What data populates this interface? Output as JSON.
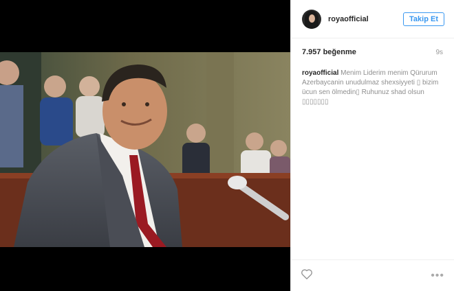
{
  "post": {
    "username": "royaofficial",
    "follow_label": "Takip Et",
    "likes": "7.957 beğenme",
    "time_ago": "9s",
    "caption_user": "royaofficial",
    "caption_text": "Menim Liderim menim Qürurum Azerbaycanin unudulmaz shexsiyyeti ▯ bizim ücun sen ölmedin▯ Ruhunuz shad olsun ▯▯▯▯▯▯▯"
  },
  "icons": {
    "like": "heart-outline-icon",
    "more": "more-options-icon"
  },
  "colors": {
    "follow_blue": "#3897f0",
    "media_bg": "#000000"
  }
}
